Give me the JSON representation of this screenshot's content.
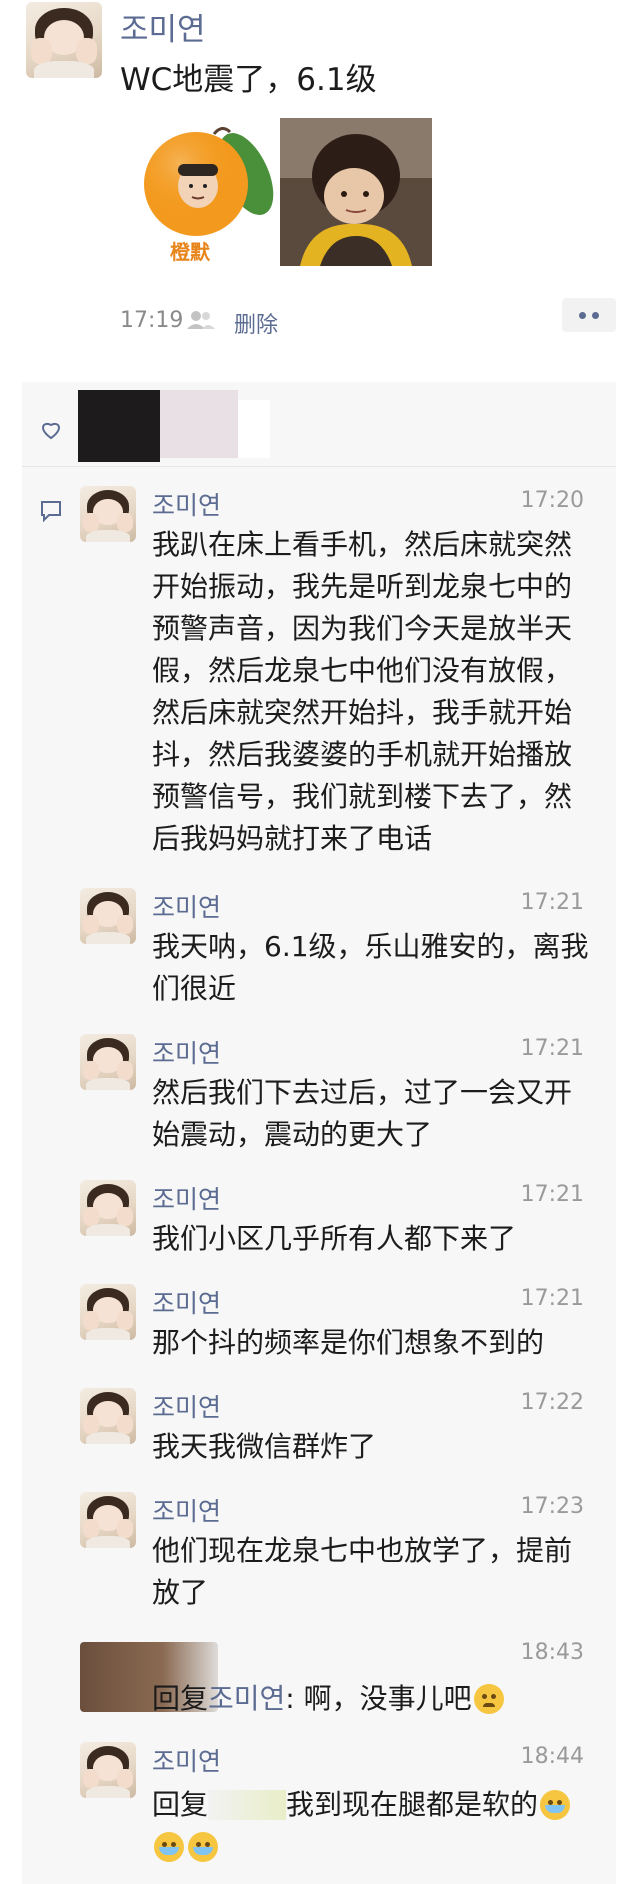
{
  "post": {
    "author": "조미연",
    "text": "WC地震了，6.1级",
    "time": "17:19",
    "delete_label": "删除",
    "image1_caption": "橙默"
  },
  "comments": [
    {
      "name": "조미연",
      "time": "17:20",
      "text": "我趴在床上看手机，然后床就突然开始振动，我先是听到龙泉七中的预警声音，因为我们今天是放半天假，然后龙泉七中他们没有放假，然后床就突然开始抖，我手就开始抖，然后我婆婆的手机就开始播放预警信号，我们就到楼下去了，然后我妈妈就打来了电话"
    },
    {
      "name": "조미연",
      "time": "17:21",
      "text": "我天呐，6.1级，乐山雅安的，离我们很近"
    },
    {
      "name": "조미연",
      "time": "17:21",
      "text": "然后我们下去过后，过了一会又开始震动，震动的更大了"
    },
    {
      "name": "조미연",
      "time": "17:21",
      "text": "我们小区几乎所有人都下来了"
    },
    {
      "name": "조미연",
      "time": "17:21",
      "text": "那个抖的频率是你们想象不到的"
    },
    {
      "name": "조미연",
      "time": "17:22",
      "text": "我天我微信群炸了"
    },
    {
      "name": "조미연",
      "time": "17:23",
      "text": "他们现在龙泉七中也放学了，提前放了"
    }
  ],
  "reply1": {
    "time": "18:43",
    "prefix": "回复",
    "target": "조미연",
    "text": ": 啊，没事儿吧"
  },
  "reply2": {
    "name": "조미연",
    "time": "18:44",
    "prefix": "回复",
    "text": "我到现在腿都是软的"
  },
  "colors": {
    "name_blue": "#5b6b91",
    "comment_bg": "#f7f7f7"
  }
}
